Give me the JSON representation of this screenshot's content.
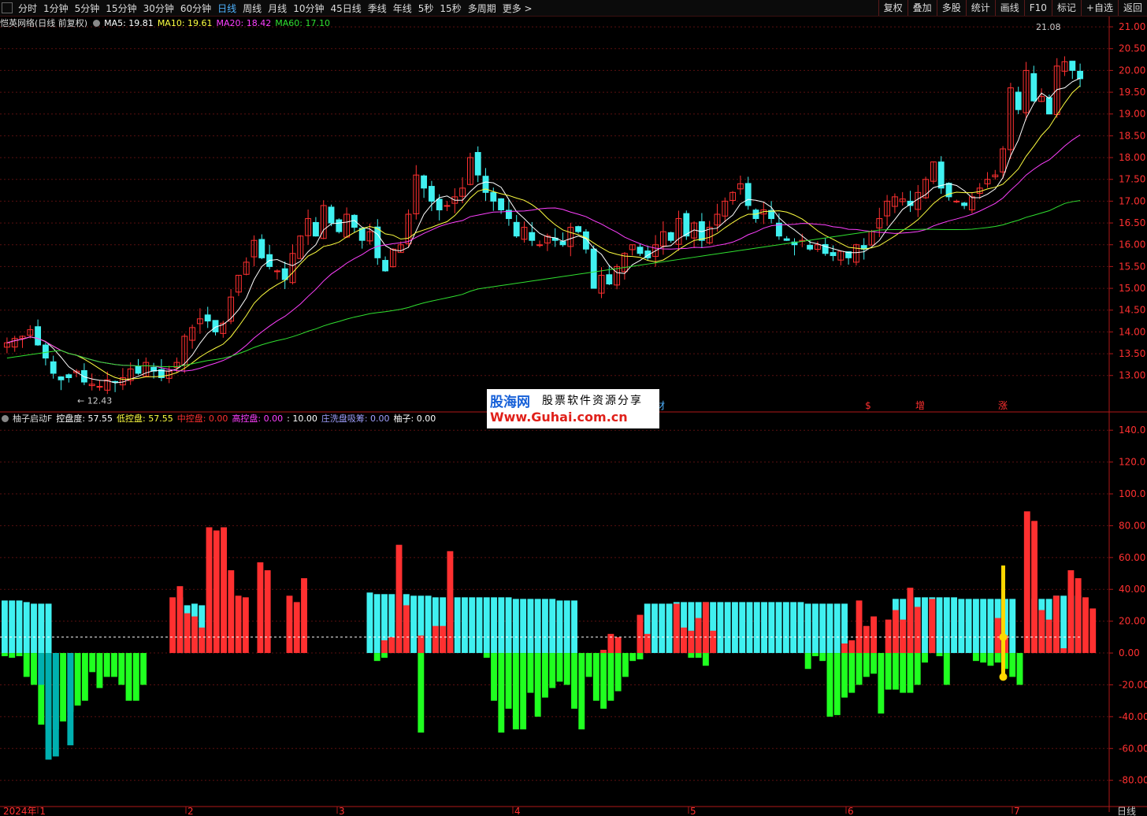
{
  "toolbar": {
    "periods": [
      "分时",
      "1分钟",
      "5分钟",
      "15分钟",
      "30分钟",
      "60分钟",
      "日线",
      "周线",
      "月线",
      "10分钟",
      "45日线",
      "季线",
      "年线",
      "5秒",
      "15秒",
      "多周期",
      "更多 >"
    ],
    "active_period": "日线",
    "right_buttons": [
      "复权",
      "叠加",
      "多股",
      "统计",
      "画线",
      "F10",
      "标记",
      "+自选",
      "返回"
    ]
  },
  "main_info": {
    "title": "恺英网络(日线 前复权)",
    "ma": [
      {
        "label": "MA5: 19.81",
        "color": "#ffffff"
      },
      {
        "label": "MA10: 19.61",
        "color": "#ffff40"
      },
      {
        "label": "MA20: 18.42",
        "color": "#ff40ff"
      },
      {
        "label": "MA60: 17.10",
        "color": "#30e030"
      }
    ]
  },
  "sub_info": {
    "title": "柚子启动F",
    "items": [
      {
        "label": "控盘度: 57.55",
        "color": "#ffffff"
      },
      {
        "label": "低控盘: 57.55",
        "color": "#ffff40"
      },
      {
        "label": "中控盘: 0.00",
        "color": "#ff3030"
      },
      {
        "label": "高控盘: 0.00",
        "color": "#ff40ff"
      },
      {
        "label": ": 10.00",
        "color": "#ffffff"
      },
      {
        "label": "庄洗盘吸筹: 0.00",
        "color": "#a0a0ff"
      },
      {
        "label": "柚子: 0.00",
        "color": "#ffffff"
      }
    ]
  },
  "price_axis": [
    "21.00",
    "20.50",
    "20.00",
    "19.50",
    "19.00",
    "18.50",
    "18.00",
    "17.50",
    "17.00",
    "16.50",
    "16.00",
    "15.50",
    "15.00",
    "14.50",
    "14.00",
    "13.50",
    "13.00"
  ],
  "sub_axis": [
    "140.0",
    "120.0",
    "100.0",
    "80.00",
    "60.00",
    "40.00",
    "20.00",
    "0.00",
    "-20.00",
    "-40.00",
    "-60.00",
    "-80.00"
  ],
  "annotations": {
    "high": "21.08",
    "low": "12.43"
  },
  "date_axis": [
    {
      "label": "2024年 1"
    },
    {
      "label": "2"
    },
    {
      "label": "3"
    },
    {
      "label": "4"
    },
    {
      "label": "5"
    },
    {
      "label": "6"
    },
    {
      "label": "7"
    }
  ],
  "bottom_right_label": "日线",
  "markers": [
    "材",
    "$",
    "增",
    "涨"
  ],
  "logo": {
    "line1": "股海网",
    "line1b": "股票软件资源分享",
    "line2": "Www.Guhai.com.cn"
  },
  "colors": {
    "up": "#ff3030",
    "down": "#40f0f0",
    "ma5": "#ffffff",
    "ma10": "#ffff40",
    "ma20": "#ff40ff",
    "ma60": "#30e030",
    "axis": "#b01818",
    "label": "#ff3030"
  },
  "chart_data": [
    {
      "type": "candlestick",
      "title": "恺英网络(日线 前复权)",
      "x_ticks": [
        "2024年 1",
        "2",
        "3",
        "4",
        "5",
        "6",
        "7"
      ],
      "ylim": [
        12.2,
        21.2
      ],
      "y_ticks": [
        13.0,
        13.5,
        14.0,
        14.5,
        15.0,
        15.5,
        16.0,
        16.5,
        17.0,
        17.5,
        18.0,
        18.5,
        19.0,
        19.5,
        20.0,
        20.5,
        21.0
      ],
      "close": [
        13.75,
        13.85,
        13.9,
        14.05,
        13.7,
        13.4,
        13.05,
        12.9,
        12.95,
        13.1,
        12.85,
        12.8,
        12.75,
        12.9,
        12.85,
        12.95,
        13.15,
        13.05,
        13.3,
        13.1,
        12.95,
        13.1,
        13.3,
        13.9,
        14.1,
        14.3,
        14.25,
        14.0,
        14.2,
        14.8,
        15.3,
        15.6,
        16.1,
        15.7,
        15.5,
        15.4,
        15.2,
        15.8,
        16.2,
        16.6,
        16.2,
        16.9,
        16.5,
        16.3,
        16.7,
        16.4,
        16.1,
        16.3,
        15.7,
        15.4,
        15.9,
        16.0,
        16.7,
        17.6,
        17.3,
        17.0,
        16.8,
        16.9,
        17.1,
        17.3,
        18.0,
        17.6,
        17.2,
        17.0,
        16.8,
        16.6,
        16.2,
        16.4,
        16.1,
        16.0,
        16.2,
        16.1,
        16.0,
        16.4,
        16.3,
        15.9,
        15.0,
        15.3,
        15.1,
        15.5,
        15.8,
        16.0,
        15.8,
        15.7,
        16.0,
        16.3,
        16.1,
        16.6,
        16.2,
        16.5,
        16.1,
        16.4,
        16.7,
        17.0,
        17.2,
        17.4,
        16.9,
        16.6,
        16.8,
        16.6,
        16.2,
        16.1,
        16.0,
        16.1,
        15.9,
        16.0,
        15.8,
        15.75,
        15.85,
        15.7,
        16.0,
        15.9,
        16.3,
        16.6,
        17.0,
        17.1,
        17.05,
        16.9,
        17.2,
        17.5,
        17.9,
        17.3,
        17.1,
        17.0,
        16.9,
        17.1,
        17.3,
        17.5,
        17.6,
        18.2,
        19.6,
        19.1,
        20.0,
        19.3,
        19.4,
        19.0,
        20.1,
        20.2,
        20.0,
        19.81
      ],
      "low": 12.43,
      "high": 21.08
    },
    {
      "type": "line",
      "series": [
        {
          "name": "MA5",
          "color": "#ffffff"
        },
        {
          "name": "MA10",
          "color": "#ffff40"
        },
        {
          "name": "MA20",
          "color": "#ff40ff"
        },
        {
          "name": "MA60",
          "color": "#30e030"
        }
      ]
    },
    {
      "type": "bar",
      "title": "柚子启动F",
      "ylim": [
        -95,
        150
      ],
      "y_ticks": [
        -80,
        -60,
        -40,
        -20,
        0,
        20,
        40,
        60,
        80,
        100,
        120,
        140
      ],
      "series": [
        {
          "name": "低控盘",
          "color": "#40f0f0",
          "values": [
            33,
            33,
            33,
            32,
            31,
            31,
            31,
            0,
            0,
            0,
            0,
            0,
            0,
            0,
            0,
            0,
            0,
            0,
            0,
            0,
            0,
            0,
            0,
            0,
            35,
            30,
            31,
            30,
            0,
            0,
            0,
            0,
            0,
            0,
            0,
            0,
            0,
            0,
            0,
            0,
            0,
            0,
            0,
            0,
            0,
            0,
            0,
            0,
            0,
            0,
            38,
            37,
            37,
            37,
            37,
            37,
            36,
            36,
            36,
            35,
            35,
            35,
            35,
            35,
            35,
            35,
            35,
            35,
            35,
            35,
            34,
            34,
            34,
            34,
            34,
            34,
            33,
            33,
            33,
            0,
            0,
            0,
            0,
            0,
            0,
            0,
            0,
            0,
            31,
            31,
            31,
            31,
            32,
            32,
            32,
            32,
            32,
            32,
            32,
            32,
            32,
            32,
            32,
            32,
            32,
            32,
            32,
            32,
            32,
            32,
            31,
            31,
            31,
            31,
            31,
            31,
            0,
            0,
            0,
            0,
            0,
            0,
            34,
            34,
            35,
            35,
            35,
            35,
            35,
            35,
            35,
            34,
            34,
            34,
            34,
            34,
            34,
            34,
            34,
            0,
            0,
            34,
            34,
            34,
            36,
            36,
            36,
            36
          ]
        },
        {
          "name": "中控盘",
          "color": "#ff3030",
          "values": [
            0,
            0,
            0,
            0,
            0,
            0,
            0,
            0,
            0,
            0,
            0,
            0,
            0,
            0,
            0,
            0,
            0,
            0,
            0,
            0,
            0,
            0,
            0,
            35,
            42,
            25,
            23,
            16,
            79,
            77,
            79,
            52,
            36,
            35,
            0,
            57,
            52,
            0,
            0,
            36,
            32,
            47,
            0,
            0,
            0,
            0,
            0,
            0,
            0,
            0,
            0,
            0,
            8,
            10,
            68,
            30,
            0,
            11,
            0,
            17,
            17,
            64,
            0,
            0,
            0,
            0,
            0,
            0,
            0,
            0,
            0,
            0,
            0,
            0,
            0,
            0,
            0,
            0,
            0,
            0,
            0,
            0,
            2,
            12,
            10,
            0,
            0,
            24,
            12,
            0,
            0,
            0,
            31,
            16,
            14,
            22,
            32,
            14,
            0,
            0,
            0,
            0,
            0,
            0,
            0,
            0,
            0,
            0,
            0,
            0,
            0,
            0,
            0,
            0,
            0,
            6,
            8,
            33,
            17,
            23,
            0,
            21,
            27,
            21,
            41,
            29,
            0,
            34,
            0,
            0,
            0,
            0,
            0,
            0,
            0,
            0,
            22,
            11,
            0,
            0,
            89,
            83,
            27,
            21,
            36,
            3,
            52,
            47,
            35,
            28
          ]
        },
        {
          "name": "庄洗盘吸筹",
          "color": "#20ff20",
          "values": [
            -2,
            -3,
            -2,
            -15,
            -20,
            -45,
            -48,
            -48,
            -43,
            -37,
            -33,
            -30,
            -12,
            -22,
            -15,
            -15,
            -20,
            -30,
            -30,
            -20,
            0,
            0,
            0,
            0,
            0,
            0,
            0,
            0,
            0,
            0,
            0,
            0,
            0,
            0,
            0,
            0,
            0,
            0,
            0,
            0,
            0,
            0,
            0,
            0,
            0,
            0,
            0,
            0,
            0,
            0,
            0,
            -5,
            -3,
            0,
            0,
            0,
            0,
            -50,
            0,
            0,
            0,
            0,
            0,
            0,
            0,
            0,
            -3,
            -30,
            -50,
            -35,
            -48,
            -48,
            -25,
            -40,
            -28,
            -22,
            -18,
            -20,
            -35,
            -48,
            -15,
            -30,
            -35,
            -30,
            -24,
            -15,
            -5,
            -4,
            0,
            0,
            0,
            0,
            0,
            0,
            -3,
            -3,
            -8,
            0,
            0,
            0,
            0,
            0,
            0,
            0,
            0,
            0,
            0,
            0,
            0,
            0,
            -10,
            -2,
            -5,
            -40,
            -39,
            -28,
            -25,
            -20,
            -15,
            -13,
            -38,
            -23,
            -23,
            -25,
            -25,
            -20,
            -6,
            0,
            -2,
            -20,
            0,
            0,
            0,
            -5,
            -6,
            -8,
            -6,
            -10,
            -15,
            -20,
            0,
            0,
            0,
            0,
            0,
            0,
            0,
            0,
            0,
            0,
            0,
            0,
            0,
            0,
            0,
            0,
            0,
            0,
            0
          ]
        },
        {
          "name": "高控盘",
          "color": "#00b0b0",
          "values": [
            0,
            0,
            0,
            0,
            0,
            -20,
            -67,
            -65,
            0,
            -58,
            0,
            0,
            0,
            0,
            0,
            0,
            0,
            0,
            0,
            0,
            0,
            0,
            0,
            0,
            0,
            0,
            0,
            0,
            0,
            0,
            0,
            0,
            0,
            0,
            0,
            0,
            0,
            0,
            0,
            0,
            0,
            0,
            0,
            0,
            0,
            0,
            0,
            0,
            0,
            0,
            0,
            0,
            0,
            0,
            0,
            0,
            0,
            0,
            0,
            0,
            0,
            0,
            0,
            0,
            0,
            0,
            0,
            0,
            0,
            0,
            0,
            0,
            0,
            0,
            0,
            0,
            0,
            0,
            0,
            0,
            0,
            0,
            0,
            0,
            0,
            0,
            0,
            0,
            0,
            0,
            0,
            0,
            0,
            0,
            0,
            0,
            0,
            0,
            0,
            0,
            0,
            0,
            0,
            0,
            0,
            0,
            0,
            0,
            0,
            0,
            0,
            0,
            0,
            0,
            0,
            0,
            0,
            0,
            0,
            0,
            0,
            0,
            0,
            0,
            0,
            0,
            0,
            0,
            0,
            0,
            0,
            0,
            0,
            0,
            0,
            0,
            0,
            0,
            0,
            0,
            0,
            0,
            0,
            0,
            0,
            0,
            0,
            0,
            0,
            0,
            0,
            0,
            0
          ]
        }
      ],
      "reference_line": 10
    }
  ]
}
